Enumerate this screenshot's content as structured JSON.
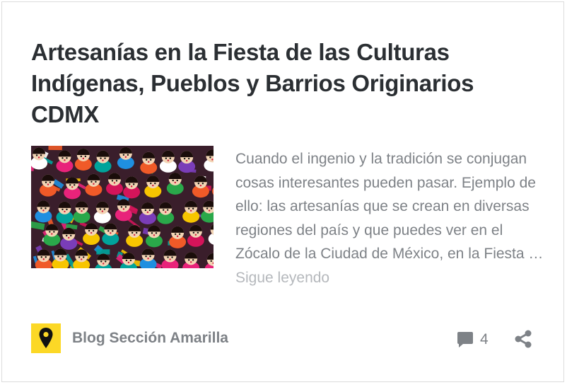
{
  "post": {
    "title": "Artesanías en la Fiesta de las Culturas Indígenas, Pueblos y Barrios Originarios CDMX",
    "excerpt": "Cuando el ingenio y la tradición se conjugan cosas interesantes pueden pasar. Ejemplo de ello: las artesanías que se crean en diversas regiones del país y que puedes ver en el Zócalo de la Ciudad de México, en la Fiesta …",
    "read_more": "Sigue leyendo",
    "image_icon": "photo-colorful-handmade-dolls"
  },
  "footer": {
    "author": "Blog Sección Amarilla",
    "author_icon": "map-pin-icon",
    "comment_count": "4",
    "comment_icon": "speech-bubble-icon",
    "share_icon": "share-icon"
  },
  "colors": {
    "title": "#2b2f33",
    "text": "#7e8287",
    "read_more": "#b5b8bc",
    "brand_yellow": "#fcd826",
    "icon": "#7e8287"
  }
}
